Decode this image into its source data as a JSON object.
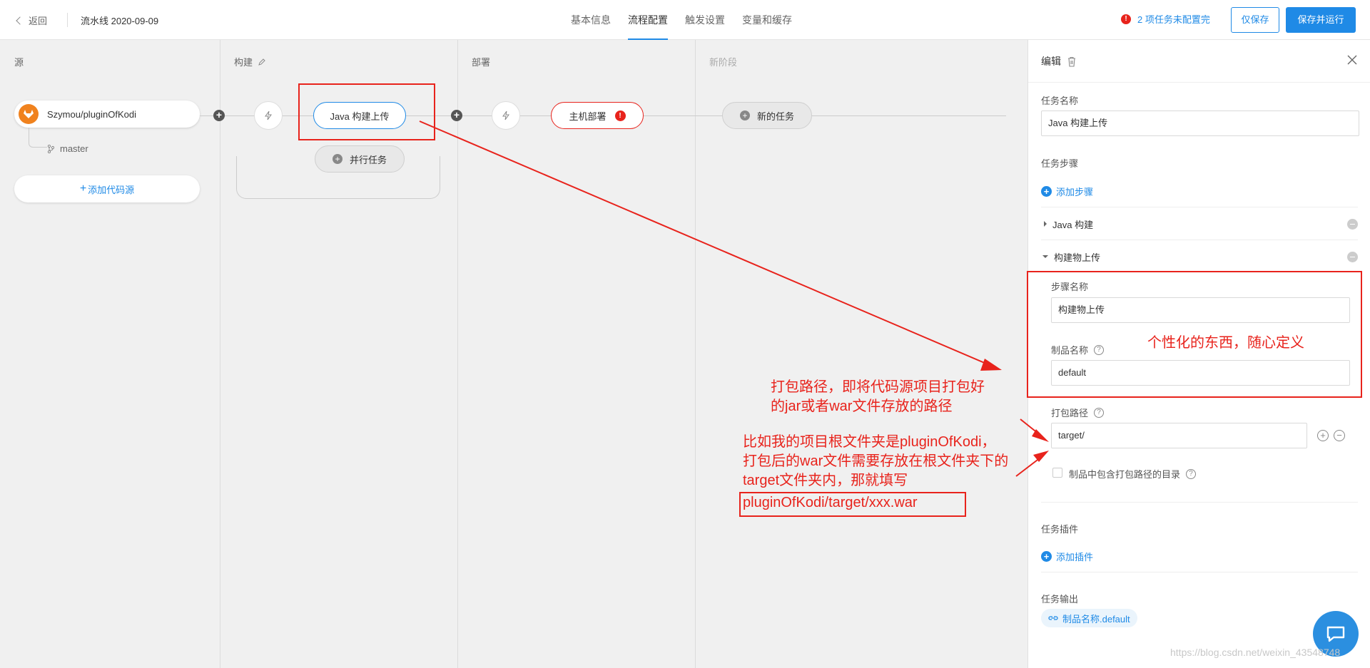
{
  "header": {
    "back_label": "返回",
    "pipeline_title": "流水线 2020-09-09",
    "tabs": [
      "基本信息",
      "流程配置",
      "触发设置",
      "变量和缓存"
    ],
    "active_tab": "流程配置",
    "warning_text": "2 项任务未配置完",
    "save_label": "仅保存",
    "save_run_label": "保存并运行",
    "accent_color": "#1f8ae6"
  },
  "canvas": {
    "columns": [
      "源",
      "构建",
      "部署",
      "新阶段"
    ],
    "source": {
      "repo": "Szymou/pluginOfKodi",
      "branch": "master",
      "add_source_label": "添加代码源"
    },
    "tasks": {
      "java_build": "Java 构建上传",
      "parallel": "并行任务",
      "host_deploy": "主机部署",
      "new_task": "新的任务"
    }
  },
  "panel": {
    "title": "编辑",
    "task_name_label": "任务名称",
    "task_name_value": "Java 构建上传",
    "task_steps_label": "任务步骤",
    "add_step_label": "添加步骤",
    "steps": [
      "Java 构建",
      "构建物上传"
    ],
    "step_name_label": "步骤名称",
    "step_name_value": "构建物上传",
    "artifact_name_label": "制品名称",
    "artifact_name_value": "default",
    "package_path_label": "打包路径",
    "package_path_value": "target/",
    "include_dir_label": "制品中包含打包路径的目录",
    "plugins_label": "任务插件",
    "add_plugin_label": "添加插件",
    "output_label": "任务输出",
    "output_tag": "制品名称.default"
  },
  "annotations": {
    "custom_note": "个性化的东西，随心定义",
    "path_note_1": "打包路径，即将代码源项目打包好",
    "path_note_2": "的jar或者war文件存放的路径",
    "example_1": "比如我的项目根文件夹是pluginOfKodi，",
    "example_2": "打包后的war文件需要存放在根文件夹下的",
    "example_3": "target文件夹内，那就填写",
    "example_4": "pluginOfKodi/target/xxx.war",
    "color": "#e8231c"
  },
  "watermark": "https://blog.csdn.net/weixin_43548748"
}
